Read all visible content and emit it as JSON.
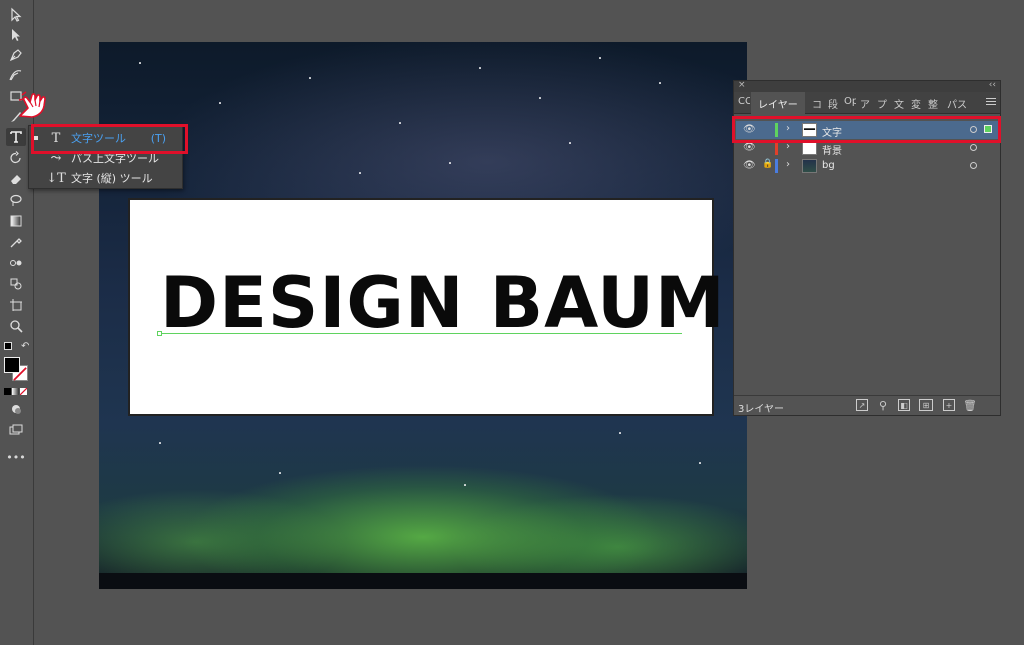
{
  "toolbar": {
    "tools": [
      "selection-tool",
      "direct-selection-tool",
      "pen-tool",
      "curvature-tool",
      "rectangle-tool",
      "paintbrush-tool",
      "type-tool",
      "rotate-tool",
      "eraser-tool",
      "lasso-tool",
      "gradient-tool",
      "eyedropper-tool",
      "blend-tool",
      "shape-builder-tool",
      "artboard-tool",
      "zoom-tool"
    ],
    "more_label": "•••"
  },
  "flyout": {
    "items": [
      {
        "icon": "T",
        "label": "文字ツール",
        "shortcut": "(T)",
        "selected": true
      },
      {
        "icon": "⤳",
        "label": "パス上文字ツール",
        "shortcut": ""
      },
      {
        "icon": "↓T",
        "label": "文字 (縦) ツール",
        "shortcut": ""
      }
    ]
  },
  "artboard": {
    "headline": "DESIGN BAUM"
  },
  "layers_panel": {
    "close_label": "×",
    "collapse_label": "‹‹",
    "tabs": [
      "CC",
      "レイヤー",
      "コ",
      "段",
      "Op",
      "ア",
      "プ",
      "文",
      "変",
      "整",
      "パス"
    ],
    "active_tab": "レイヤー",
    "layers": [
      {
        "name": "文字",
        "color": "#5fd35f",
        "locked": false,
        "selected": true
      },
      {
        "name": "背景",
        "color": "#e0402a",
        "locked": false,
        "selected": false
      },
      {
        "name": "bg",
        "color": "#4a7de0",
        "locked": true,
        "selected": false
      }
    ],
    "footer": {
      "count_label": "3レイヤー"
    }
  },
  "colors": {
    "highlight_red": "#e0102a",
    "accent_blue": "#4aa0f0",
    "selected_row": "#4b6a8e"
  }
}
